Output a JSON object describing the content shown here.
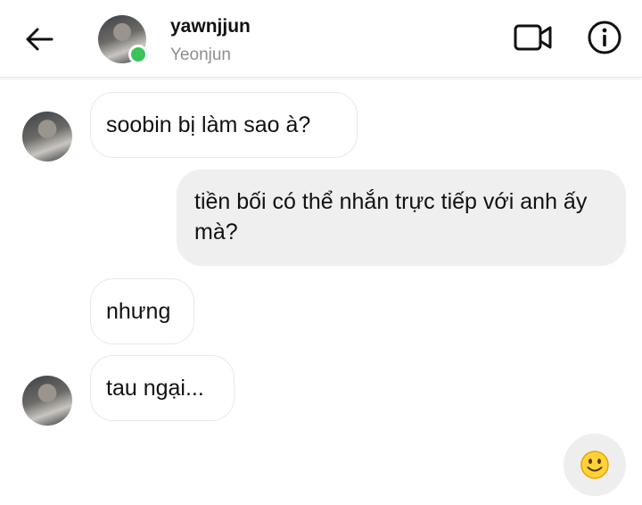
{
  "header": {
    "username": "yawnjjun",
    "display_name": "Yeonjun",
    "online": true,
    "icons": {
      "back": "arrow-left-icon",
      "video": "video-camera-icon",
      "info": "info-icon"
    }
  },
  "messages": [
    {
      "direction": "incoming",
      "text": "soobin bị làm sao à?",
      "show_avatar": true
    },
    {
      "direction": "outgoing",
      "text": "tiền bối có thể nhắn trực tiếp với anh ấy mà?"
    },
    {
      "direction": "incoming",
      "text": "nhưng",
      "show_avatar": false
    },
    {
      "direction": "incoming",
      "text": "tau ngại...",
      "show_avatar": true
    }
  ],
  "composer": {
    "emoji_icon": "smiling-face-icon",
    "emoji": "🙂"
  },
  "colors": {
    "incoming_bubble": "#ffffff",
    "outgoing_bubble": "#efefef",
    "online_dot": "#3bc35a",
    "subtitle": "#8e8e8e"
  }
}
